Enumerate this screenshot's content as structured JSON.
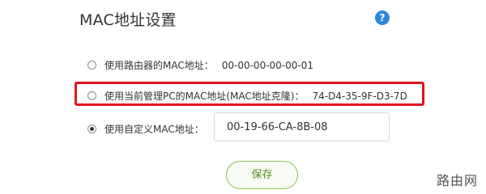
{
  "page": {
    "title": "MAC地址设置",
    "help_icon_glyph": "?"
  },
  "options": [
    {
      "label": "使用路由器的MAC地址：",
      "value": "00-00-00-00-00-01",
      "checked": false
    },
    {
      "label": "使用当前管理PC的MAC地址(MAC地址克隆)：",
      "value": "74-D4-35-9F-D3-7D",
      "checked": false,
      "highlighted": true
    },
    {
      "label": "使用自定义MAC地址：",
      "checked": true
    }
  ],
  "custom_mac": {
    "value": "00-19-66-CA-8B-08"
  },
  "actions": {
    "save_label": "保存"
  },
  "watermark": {
    "text": "路由网"
  },
  "colors": {
    "highlight_border": "#e1131d",
    "help_icon": "#2f86d8",
    "save_border": "#8bc34a",
    "save_text": "#5a8f1e"
  }
}
